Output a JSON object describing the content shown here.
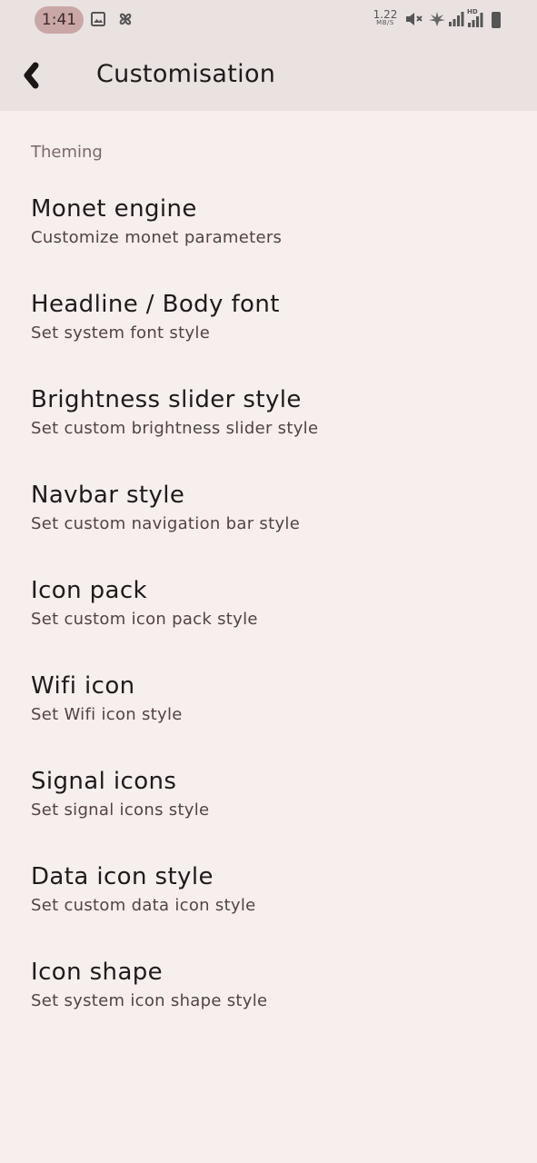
{
  "status_bar": {
    "time": "1:41",
    "net_speed_value": "1.22",
    "net_speed_unit": "MB/S",
    "network_badge": "HD",
    "icons": [
      "image-icon",
      "pinwheel-icon",
      "mute-icon",
      "leaf-icon",
      "signal-icon",
      "signal-hd-icon",
      "battery-icon"
    ]
  },
  "app_bar": {
    "back_icon": "back-arrow-icon",
    "title": "Customisation"
  },
  "section": {
    "header": "Theming"
  },
  "items": [
    {
      "title": "Monet engine",
      "summary": "Customize monet parameters"
    },
    {
      "title": "Headline / Body font",
      "summary": "Set system font style"
    },
    {
      "title": "Brightness slider style",
      "summary": "Set custom brightness slider style"
    },
    {
      "title": "Navbar style",
      "summary": "Set custom navigation bar style"
    },
    {
      "title": "Icon pack",
      "summary": "Set custom icon pack style"
    },
    {
      "title": "Wifi icon",
      "summary": "Set Wifi icon style"
    },
    {
      "title": "Signal icons",
      "summary": "Set signal icons style"
    },
    {
      "title": "Data icon style",
      "summary": "Set custom data icon style"
    },
    {
      "title": "Icon shape",
      "summary": "Set system icon shape style"
    }
  ],
  "colors": {
    "background": "#f6efee",
    "app_bar": "#e9e2e1",
    "time_pill": "#c9a7a6"
  }
}
